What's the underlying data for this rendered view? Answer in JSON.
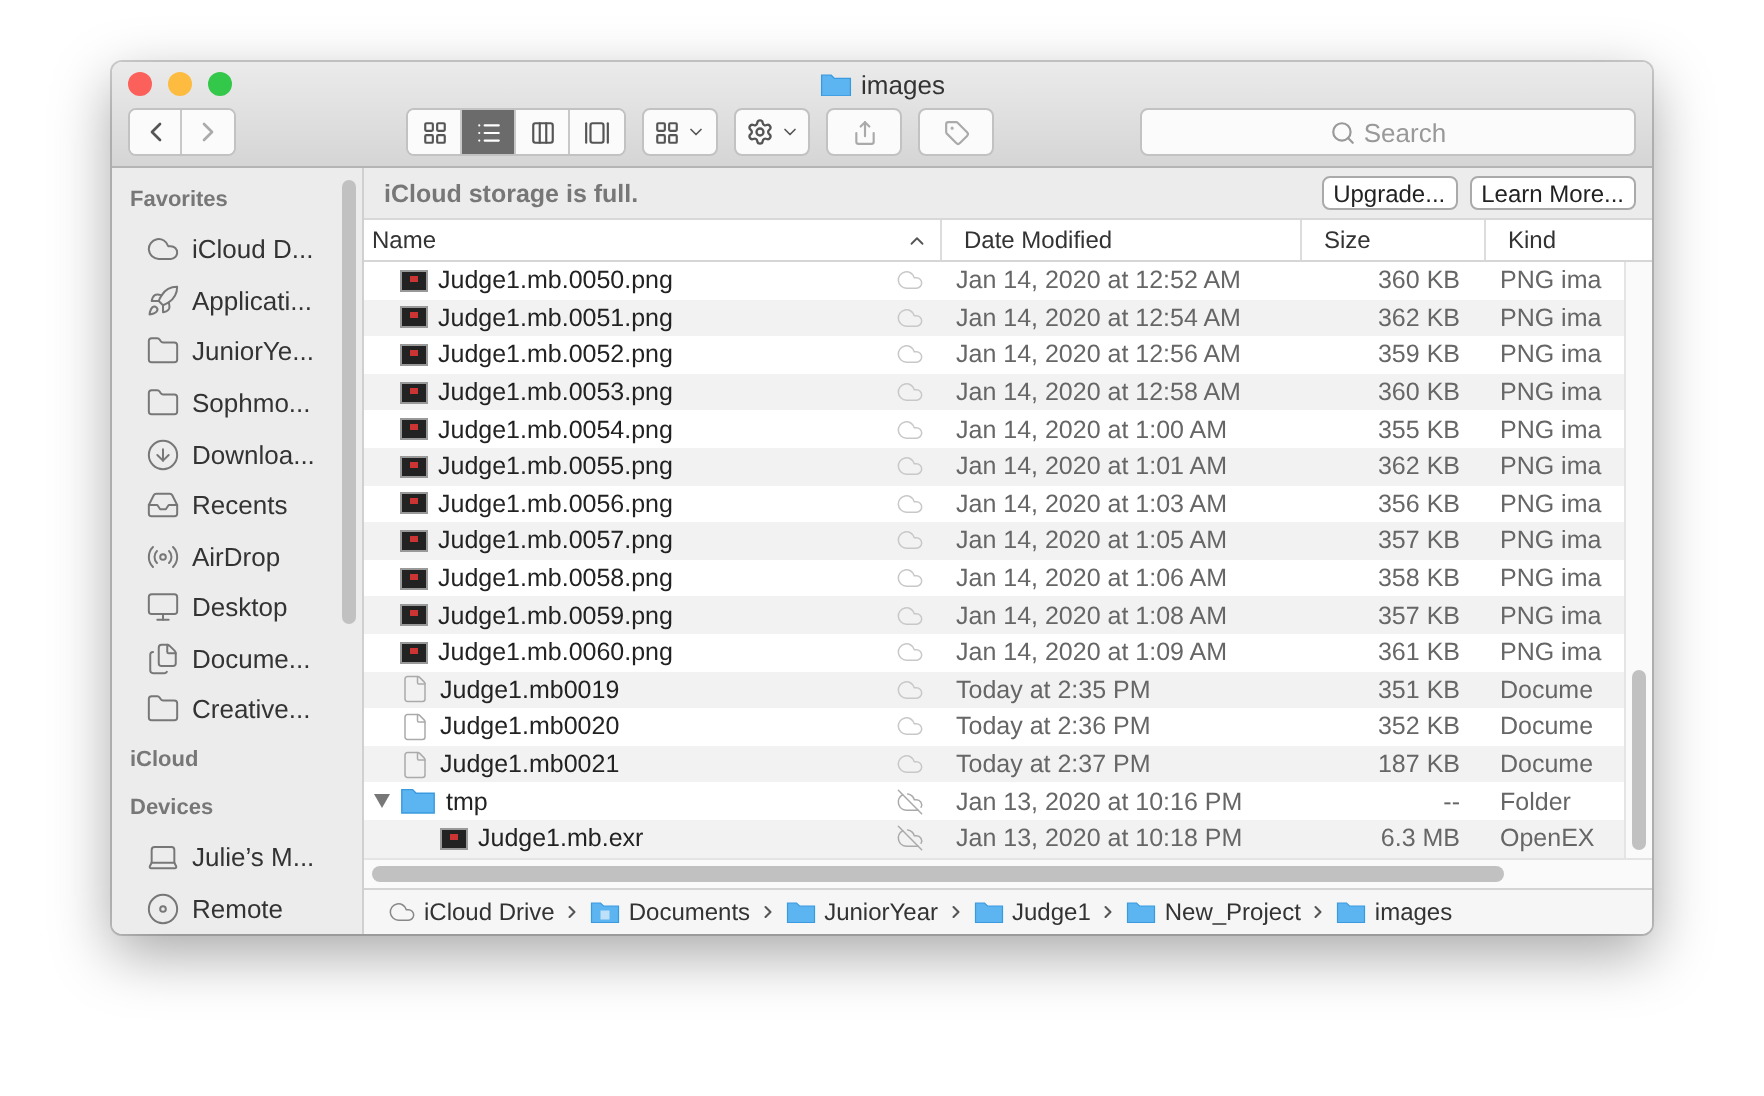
{
  "window": {
    "title": "images"
  },
  "toolbar": {
    "views": [
      {
        "kind": "icons",
        "selected": false
      },
      {
        "kind": "list",
        "selected": true
      },
      {
        "kind": "columns",
        "selected": false
      },
      {
        "kind": "gallery",
        "selected": false
      }
    ],
    "search": {
      "placeholder": "Search"
    }
  },
  "sidebar": {
    "sections": [
      {
        "title": "Favorites",
        "items": [
          {
            "label": "iCloud D...",
            "kind": "cloud"
          },
          {
            "label": "Applicati...",
            "kind": "apps"
          },
          {
            "label": "JuniorYe...",
            "kind": "folder"
          },
          {
            "label": "Sophmo...",
            "kind": "folder"
          },
          {
            "label": "Downloa...",
            "kind": "download"
          },
          {
            "label": "Recents",
            "kind": "recents"
          },
          {
            "label": "AirDrop",
            "kind": "airdrop"
          },
          {
            "label": "Desktop",
            "kind": "desktop"
          },
          {
            "label": "Docume...",
            "kind": "documents"
          },
          {
            "label": "Creative...",
            "kind": "folder"
          }
        ]
      },
      {
        "title": "iCloud"
      },
      {
        "title": "Devices",
        "items": [
          {
            "label": "Julie’s M...",
            "kind": "laptop"
          },
          {
            "label": "Remote",
            "kind": "disc"
          }
        ]
      }
    ]
  },
  "banner": {
    "message": "iCloud storage is full.",
    "buttons": [
      "Upgrade...",
      "Learn More..."
    ]
  },
  "table": {
    "columns": [
      {
        "label": "Name",
        "sorted": true
      },
      {
        "label": "Date Modified",
        "sorted": false
      },
      {
        "label": "Size",
        "sorted": false
      },
      {
        "label": "Kind",
        "sorted": false
      }
    ],
    "rows": [
      {
        "name": "Judge1.mb.0050.png",
        "kind": "image",
        "cloud_warning": true,
        "date": "Jan 14, 2020 at 12:52 AM",
        "size": "360 KB",
        "kind_text": "PNG ima"
      },
      {
        "name": "Judge1.mb.0051.png",
        "kind": "image",
        "cloud_warning": true,
        "date": "Jan 14, 2020 at 12:54 AM",
        "size": "362 KB",
        "kind_text": "PNG ima"
      },
      {
        "name": "Judge1.mb.0052.png",
        "kind": "image",
        "cloud_warning": true,
        "date": "Jan 14, 2020 at 12:56 AM",
        "size": "359 KB",
        "kind_text": "PNG ima"
      },
      {
        "name": "Judge1.mb.0053.png",
        "kind": "image",
        "cloud_warning": true,
        "date": "Jan 14, 2020 at 12:58 AM",
        "size": "360 KB",
        "kind_text": "PNG ima"
      },
      {
        "name": "Judge1.mb.0054.png",
        "kind": "image",
        "cloud_warning": true,
        "date": "Jan 14, 2020 at 1:00 AM",
        "size": "355 KB",
        "kind_text": "PNG ima"
      },
      {
        "name": "Judge1.mb.0055.png",
        "kind": "image",
        "cloud_warning": true,
        "date": "Jan 14, 2020 at 1:01 AM",
        "size": "362 KB",
        "kind_text": "PNG ima"
      },
      {
        "name": "Judge1.mb.0056.png",
        "kind": "image",
        "cloud_warning": true,
        "date": "Jan 14, 2020 at 1:03 AM",
        "size": "356 KB",
        "kind_text": "PNG ima"
      },
      {
        "name": "Judge1.mb.0057.png",
        "kind": "image",
        "cloud_warning": true,
        "date": "Jan 14, 2020 at 1:05 AM",
        "size": "357 KB",
        "kind_text": "PNG ima"
      },
      {
        "name": "Judge1.mb.0058.png",
        "kind": "image",
        "cloud_warning": true,
        "date": "Jan 14, 2020 at 1:06 AM",
        "size": "358 KB",
        "kind_text": "PNG ima"
      },
      {
        "name": "Judge1.mb.0059.png",
        "kind": "image",
        "cloud_warning": true,
        "date": "Jan 14, 2020 at 1:08 AM",
        "size": "357 KB",
        "kind_text": "PNG ima"
      },
      {
        "name": "Judge1.mb.0060.png",
        "kind": "image",
        "cloud_warning": true,
        "date": "Jan 14, 2020 at 1:09 AM",
        "size": "361 KB",
        "kind_text": "PNG ima"
      },
      {
        "name": "Judge1.mb0019",
        "kind": "document",
        "cloud_warning": true,
        "date": "Today at 2:35 PM",
        "size": "351 KB",
        "kind_text": "Docume"
      },
      {
        "name": "Judge1.mb0020",
        "kind": "document",
        "cloud_warning": true,
        "date": "Today at 2:36 PM",
        "size": "352 KB",
        "kind_text": "Docume"
      },
      {
        "name": "Judge1.mb0021",
        "kind": "document",
        "cloud_warning": true,
        "date": "Today at 2:37 PM",
        "size": "187 KB",
        "kind_text": "Docume"
      },
      {
        "name": "tmp",
        "kind": "folder",
        "cloud_warning": false,
        "date": "Jan 13, 2020 at 10:16 PM",
        "size": "--",
        "kind_text": "Folder",
        "expanded": true,
        "children": [
          {
            "name": "Judge1.mb.exr",
            "kind": "image",
            "cloud_warning": false,
            "date": "Jan 13, 2020 at 10:18 PM",
            "size": "6.3 MB",
            "kind_text": "OpenEX"
          }
        ]
      }
    ]
  },
  "path_bar": [
    {
      "label": "iCloud Drive",
      "kind": "cloud"
    },
    {
      "label": "Documents",
      "kind": "documents-folder"
    },
    {
      "label": "JuniorYear",
      "kind": "folder"
    },
    {
      "label": "Judge1",
      "kind": "folder"
    },
    {
      "label": "New_Project",
      "kind": "folder"
    },
    {
      "label": "images",
      "kind": "folder"
    }
  ]
}
